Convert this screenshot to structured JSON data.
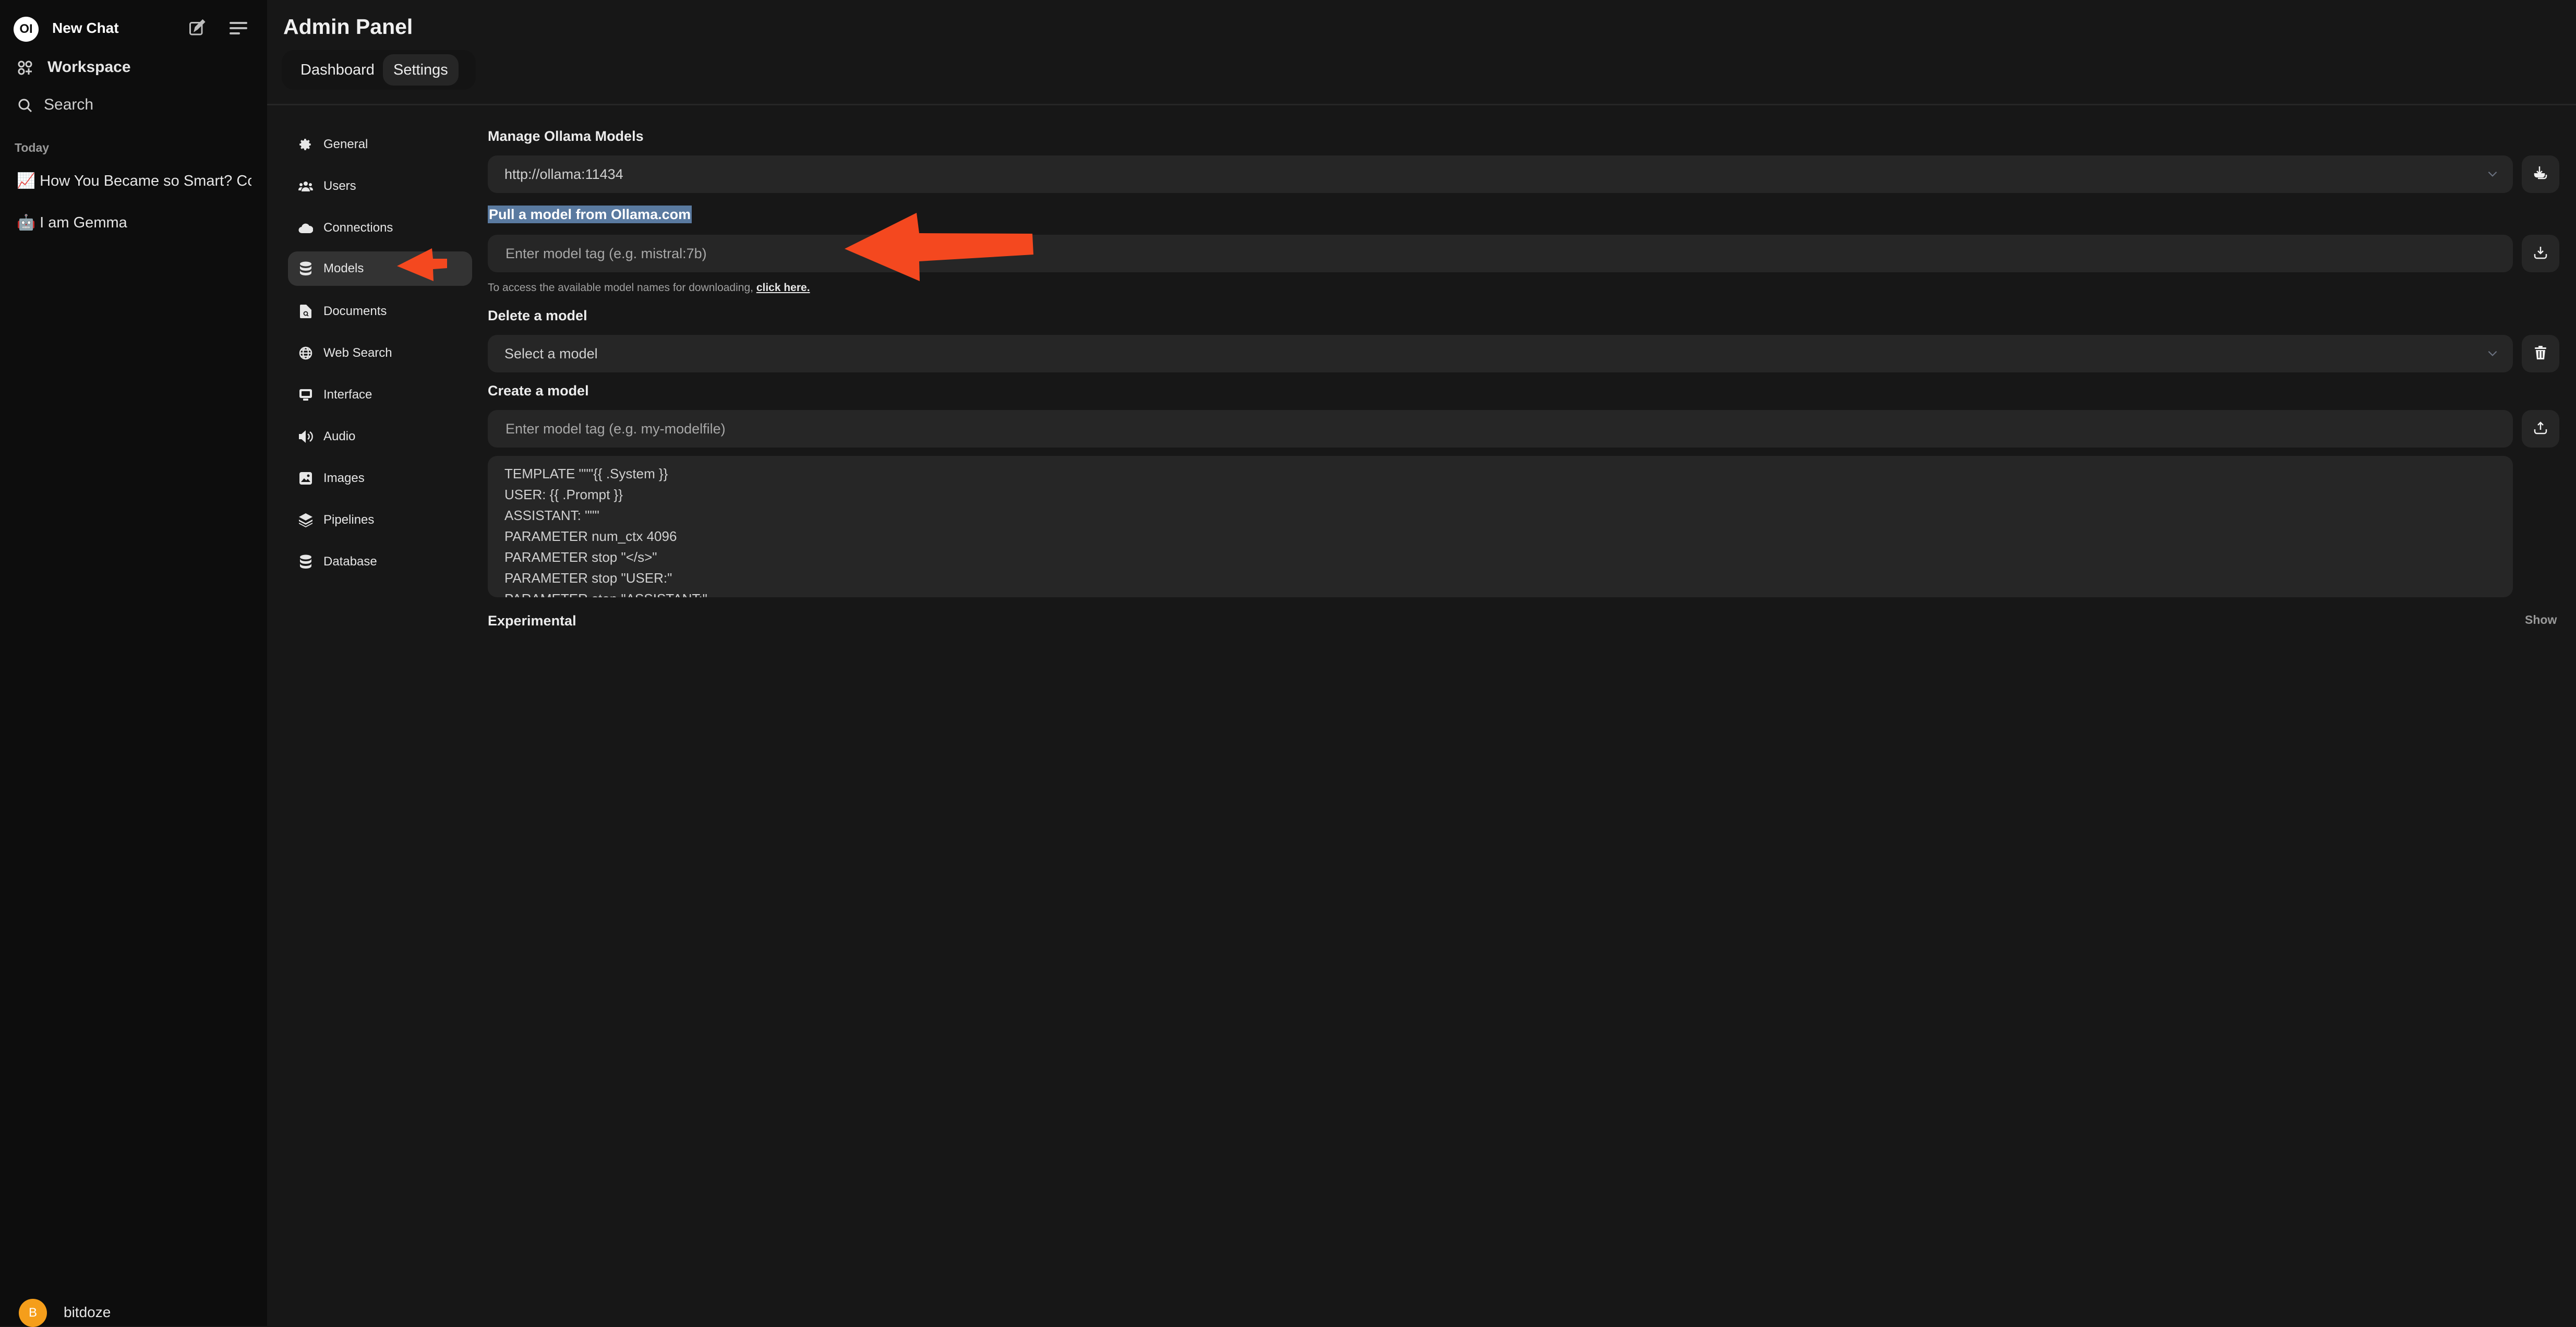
{
  "sidebar": {
    "logo_text": "OI",
    "new_chat_label": "New Chat",
    "workspace_label": "Workspace",
    "search_label": "Search",
    "section_today": "Today",
    "chats": [
      {
        "emoji": "📈",
        "title": "How You Became so Smart? Co"
      },
      {
        "emoji": "🤖",
        "title": "I am Gemma"
      }
    ],
    "user": {
      "initial": "B",
      "name": "bitdoze",
      "avatar_color": "#f59e1b"
    }
  },
  "header": {
    "title": "Admin Panel",
    "tabs": [
      {
        "label": "Dashboard",
        "active": false
      },
      {
        "label": "Settings",
        "active": true
      }
    ]
  },
  "settings_nav": {
    "items": [
      {
        "label": "General",
        "icon": "gear-icon"
      },
      {
        "label": "Users",
        "icon": "users-icon"
      },
      {
        "label": "Connections",
        "icon": "cloud-icon"
      },
      {
        "label": "Models",
        "icon": "database-icon",
        "active": true
      },
      {
        "label": "Documents",
        "icon": "document-search-icon"
      },
      {
        "label": "Web Search",
        "icon": "globe-icon"
      },
      {
        "label": "Interface",
        "icon": "monitor-icon"
      },
      {
        "label": "Audio",
        "icon": "speaker-icon"
      },
      {
        "label": "Images",
        "icon": "image-icon"
      },
      {
        "label": "Pipelines",
        "icon": "layers-icon"
      },
      {
        "label": "Database",
        "icon": "database-icon"
      }
    ]
  },
  "models": {
    "manage_label": "Manage Ollama Models",
    "ollama_url": "http://ollama:11434",
    "pull_label": "Pull a model from Ollama.com",
    "pull_placeholder": "Enter model tag (e.g. mistral:7b)",
    "helper_text": "To access the available model names for downloading, ",
    "helper_link": "click here.",
    "delete_label": "Delete a model",
    "delete_select": "Select a model",
    "create_label": "Create a model",
    "create_placeholder": "Enter model tag (e.g. my-modelfile)",
    "modelfile_lines": [
      "TEMPLATE \"\"\"{{ .System }}",
      "USER: {{ .Prompt }}",
      "ASSISTANT: \"\"\"",
      "PARAMETER num_ctx 4096",
      "PARAMETER stop \"</s>\"",
      "PARAMETER stop \"USER:\"",
      "PARAMETER stop \"ASSISTANT:\""
    ],
    "experimental_label": "Experimental",
    "show_label": "Show"
  },
  "annotations": {
    "arrow_color": "#f4481f",
    "highlight_color": "#5a7aa0"
  }
}
